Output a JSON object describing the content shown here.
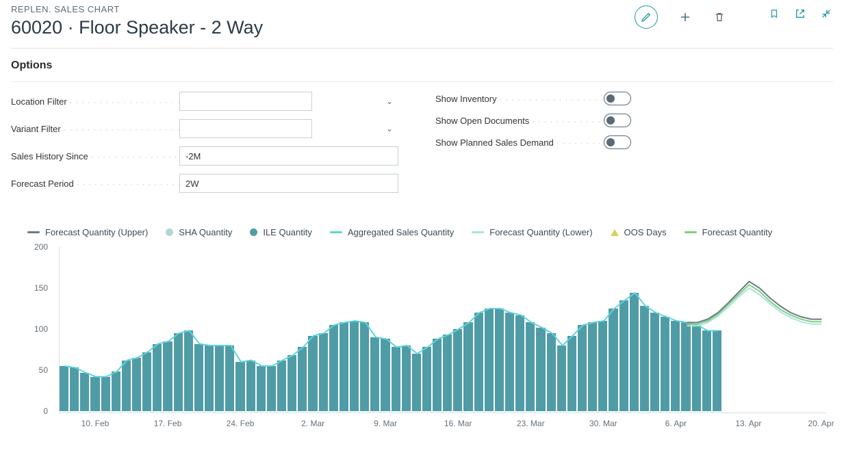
{
  "header": {
    "breadcrumb": "REPLEN. SALES CHART",
    "title": "60020 · Floor Speaker - 2 Way"
  },
  "options": {
    "section_title": "Options",
    "location_filter_label": "Location Filter",
    "location_filter_value": "",
    "variant_filter_label": "Variant Filter",
    "variant_filter_value": "",
    "sales_history_since_label": "Sales History Since",
    "sales_history_since_value": "-2M",
    "forecast_period_label": "Forecast Period",
    "forecast_period_value": "2W",
    "show_inventory_label": "Show Inventory",
    "show_inventory_on": false,
    "show_open_documents_label": "Show Open Documents",
    "show_open_documents_on": false,
    "show_planned_sales_demand_label": "Show Planned Sales Demand",
    "show_planned_sales_demand_on": false
  },
  "legend": {
    "forecast_upper": {
      "label": "Forecast Quantity (Upper)",
      "type": "line",
      "color": "#6d7984"
    },
    "sha_quantity": {
      "label": "SHA Quantity",
      "type": "dot",
      "color": "#b3d5d8"
    },
    "ile_quantity": {
      "label": "ILE Quantity",
      "type": "dot",
      "color": "#4f9ca6"
    },
    "aggregated_sales_qty": {
      "label": "Aggregated Sales Quantity",
      "type": "line",
      "color": "#5fd3db"
    },
    "forecast_lower": {
      "label": "Forecast Quantity (Lower)",
      "type": "line",
      "color": "#a9e5de"
    },
    "oos_days": {
      "label": "OOS Days",
      "type": "tri",
      "color": "#d8d15e"
    },
    "forecast_quantity": {
      "label": "Forecast Quantity",
      "type": "line",
      "color": "#7fce7f"
    }
  },
  "chart_data": {
    "type": "bar",
    "title": "",
    "xlabel": "",
    "ylabel": "",
    "ylim": [
      0,
      200
    ],
    "y_ticks": [
      0,
      50,
      100,
      150,
      200
    ],
    "x_ticks": [
      "10. Feb",
      "17. Feb",
      "24. Feb",
      "2. Mar",
      "9. Mar",
      "16. Mar",
      "23. Mar",
      "30. Mar",
      "6. Apr",
      "13. Apr",
      "20. Apr"
    ],
    "categories_tick_index": [
      3,
      10,
      17,
      24,
      31,
      38,
      45,
      52,
      59,
      66,
      73
    ],
    "n_days": 74,
    "series": [
      {
        "name": "ILE Quantity",
        "type": "bar",
        "color": "#4f9ca6",
        "values": [
          55,
          53,
          47,
          42,
          42,
          48,
          62,
          65,
          72,
          82,
          85,
          95,
          98,
          82,
          80,
          80,
          80,
          60,
          62,
          55,
          55,
          62,
          68,
          78,
          92,
          95,
          105,
          108,
          110,
          108,
          90,
          88,
          78,
          80,
          70,
          78,
          88,
          93,
          100,
          108,
          120,
          125,
          125,
          120,
          117,
          108,
          102,
          95,
          80,
          92,
          105,
          108,
          110,
          125,
          135,
          144,
          128,
          120,
          115,
          110,
          108,
          105,
          98,
          98
        ]
      },
      {
        "name": "Aggregated Sales Quantity",
        "type": "line",
        "color": "#5fd3db",
        "values": [
          55,
          53,
          47,
          42,
          42,
          48,
          62,
          65,
          72,
          82,
          85,
          95,
          98,
          82,
          80,
          80,
          80,
          60,
          62,
          55,
          55,
          62,
          68,
          78,
          92,
          95,
          105,
          108,
          110,
          108,
          90,
          88,
          78,
          80,
          70,
          78,
          88,
          93,
          100,
          108,
          120,
          125,
          125,
          120,
          117,
          108,
          102,
          95,
          80,
          92,
          105,
          108,
          110,
          125,
          135,
          144,
          128,
          120,
          115,
          110,
          108,
          105,
          98,
          98
        ]
      },
      {
        "name": "Forecast Quantity (Upper)",
        "type": "line",
        "color": "#6d7984",
        "start_index": 60,
        "values": [
          108,
          108,
          112,
          120,
          132,
          145,
          158,
          150,
          138,
          128,
          120,
          115,
          112,
          112
        ]
      },
      {
        "name": "Forecast Quantity",
        "type": "line",
        "color": "#7fce7f",
        "start_index": 60,
        "values": [
          106,
          106,
          110,
          118,
          130,
          142,
          154,
          146,
          134,
          124,
          117,
          112,
          109,
          109
        ]
      },
      {
        "name": "Forecast Quantity (Lower)",
        "type": "line",
        "color": "#a9e5de",
        "start_index": 60,
        "values": [
          104,
          104,
          108,
          116,
          127,
          139,
          150,
          142,
          131,
          121,
          114,
          109,
          106,
          106
        ]
      }
    ]
  }
}
